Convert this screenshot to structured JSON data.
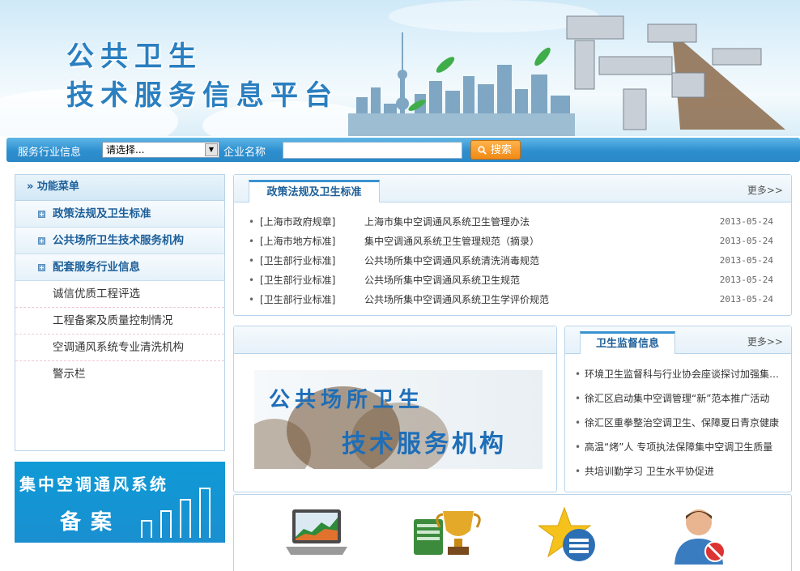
{
  "banner": {
    "title_line1": "公共卫生",
    "title_line2": "技术服务信息平台"
  },
  "search": {
    "industry_label": "服务行业信息",
    "industry_select_value": "请选择...",
    "company_label": "企业名称",
    "company_input_value": "",
    "search_button": "搜索"
  },
  "menu": {
    "header": "» 功能菜单",
    "categories": [
      "政策法规及卫生标准",
      "公共场所卫生技术服务机构",
      "配套服务行业信息"
    ],
    "sub_items": [
      "诚信优质工程评选",
      "工程备案及质量控制情况",
      "空调通风系统专业清洗机构",
      "警示栏"
    ]
  },
  "filing_banner": {
    "line1": "集中空调通风系统",
    "line2": "备案"
  },
  "policy": {
    "tab": "政策法规及卫生标准",
    "more": "更多>>",
    "rows": [
      {
        "tag": "[上海市政府规章]",
        "title": "上海市集中空调通风系统卫生管理办法",
        "date": "2013-05-24"
      },
      {
        "tag": "[上海市地方标准]",
        "title": "集中空调通风系统卫生管理规范（摘录）",
        "date": "2013-05-24"
      },
      {
        "tag": "[卫生部行业标准]",
        "title": "公共场所集中空调通风系统清洗消毒规范",
        "date": "2013-05-24"
      },
      {
        "tag": "[卫生部行业标准]",
        "title": "公共场所集中空调通风系统卫生规范",
        "date": "2013-05-24"
      },
      {
        "tag": "[卫生部行业标准]",
        "title": "公共场所集中空调通风系统卫生学评价规范",
        "date": "2013-05-24"
      }
    ]
  },
  "promo": {
    "line1": "公共场所卫生",
    "line2": "技术服务机构"
  },
  "supervise": {
    "tab": "卫生监督信息",
    "more": "更多>>",
    "items": [
      "环境卫生监督科与行业协会座谈探讨加强集中空…",
      "徐汇区启动集中空调管理“新”范本推广活动",
      "徐汇区重拳整治空调卫生、保障夏日青京健康",
      "高温“烤”人 专项执法保障集中空调卫生质量",
      "共培训勤学习 卫生水平协促进"
    ]
  },
  "icons": [
    "laptop-chart-icon",
    "trophy-icon",
    "star-list-icon",
    "user-block-icon"
  ],
  "colors": {
    "accent": "#2d8fcf",
    "title_blue": "#1d5f99",
    "search_orange": "#f08a14"
  }
}
